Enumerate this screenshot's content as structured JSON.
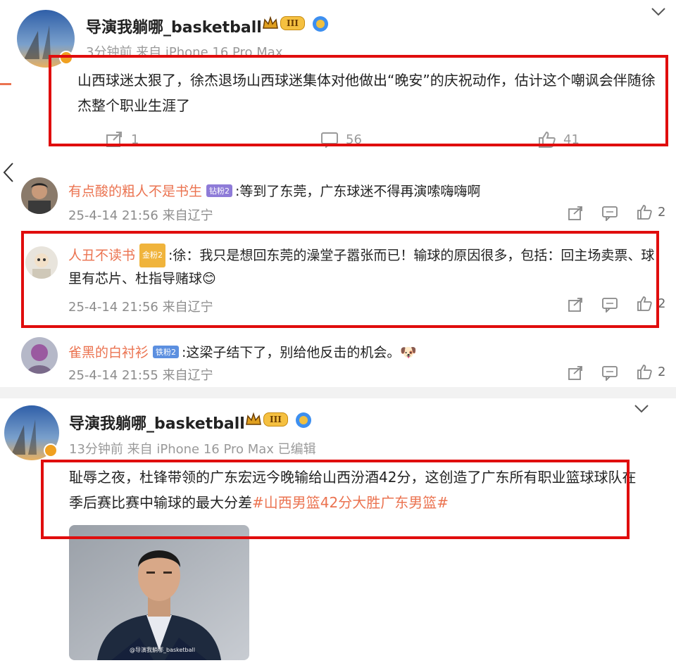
{
  "post1": {
    "username": "导演我躺哪_basketball",
    "level_badge": "III",
    "meta": "3分钟前  来自 iPhone 16 Pro Max",
    "text": "山西球迷太狠了，徐杰退场山西球迷集体对他做出“晚安”的庆祝动作，估计这个嘲讽会伴随徐杰整个职业生涯了",
    "repost_count": "1",
    "comment_count": "56",
    "like_count": "41"
  },
  "comments": [
    {
      "name": "有点酸的粗人不是书生",
      "badge": "钻粉2",
      "badge_color": "#8e7bd8",
      "text": ":等到了东莞，广东球迷不得再演嗦嗨嗨啊",
      "meta": "25-4-14 21:56 来自辽宁",
      "likes": "2"
    },
    {
      "name": "人丑不读书",
      "badge": "金粉2",
      "badge_color": "#f0b43c",
      "text": ":徐：我只是想回东莞的澡堂子嚣张而已！输球的原因很多，包括：回主场卖票、球里有芯片、杜指导赌球😊",
      "meta": "25-4-14 21:56 来自辽宁",
      "likes": "2"
    },
    {
      "name": "雀黑的白衬衫",
      "badge": "铁粉2",
      "badge_color": "#5b8fe0",
      "text": ":这梁子结下了，别给他反击的机会。🐶",
      "meta": "25-4-14 21:55 来自辽宁",
      "likes": "2"
    }
  ],
  "post2": {
    "username": "导演我躺哪_basketball",
    "level_badge": "III",
    "meta": "13分钟前  来自 iPhone 16 Pro Max 已编辑",
    "text": "耻辱之夜，杜锋带领的广东宏远今晚输给山西汾酒42分，这创造了广东所有职业篮球球队在季后赛比赛中输球的最大分差",
    "hashtag": "#山西男篮42分大胜广东男篮#",
    "image_watermark": "@导演我躺哪_basketball"
  },
  "colors": {
    "accent": "#eb7350",
    "highlight_box": "#e00d0d",
    "meta_gray": "#9a9a9a"
  }
}
